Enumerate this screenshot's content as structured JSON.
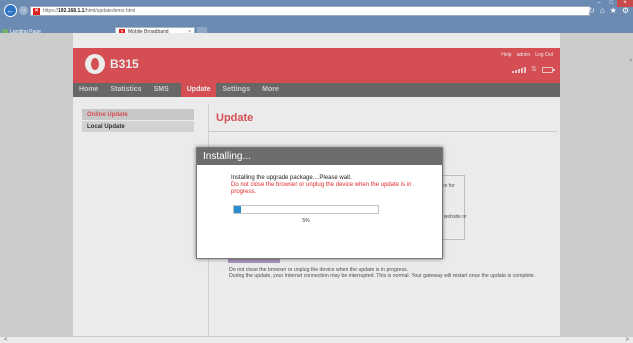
{
  "browser": {
    "url_prefix": "https://",
    "url_host": "192.168.1.1",
    "url_path": "/html/updatedemo.html",
    "favorite_label": "Landing Page",
    "tab_label": "Mobile Broadband",
    "tab_close": "×",
    "back_glyph": "←",
    "forward_glyph": "→",
    "search_glyph": "⌕",
    "refresh_glyph": "↻",
    "home_glyph": "⌂",
    "star_glyph": "★",
    "settings_glyph": "⚙",
    "minimize_glyph": "–",
    "maximize_glyph": "□",
    "close_glyph": "×",
    "accent": "#6c8bb3"
  },
  "header": {
    "model": "B315",
    "links": [
      "Help",
      "admin",
      "Log Out"
    ],
    "brand_color": "#e8555b"
  },
  "menu": {
    "items": [
      "Home",
      "Statistics",
      "SMS",
      "Update",
      "Settings",
      "More"
    ],
    "active": "Update"
  },
  "sidebar": {
    "items": [
      "Online Update",
      "Local Update"
    ],
    "active": "Online Update"
  },
  "content": {
    "title": "Update",
    "frag1": "ice for",
    "frag2": "t website or",
    "notice_line1": "Do not close the browser or unplug the device when the update is in progress.",
    "notice_line2": "During the update, your Internet connection may be interrupted. This is normal. Your gateway will restart once the update is complete."
  },
  "modal": {
    "title": "Installing...",
    "message": "Installing the upgrade package....Please wait.",
    "warning": "Do not close the browser or unplug the device when the update is in progress.",
    "progress_percent": 5,
    "progress_label": "5%"
  },
  "scroll": {
    "left_glyph": "<",
    "right_glyph": ">"
  }
}
